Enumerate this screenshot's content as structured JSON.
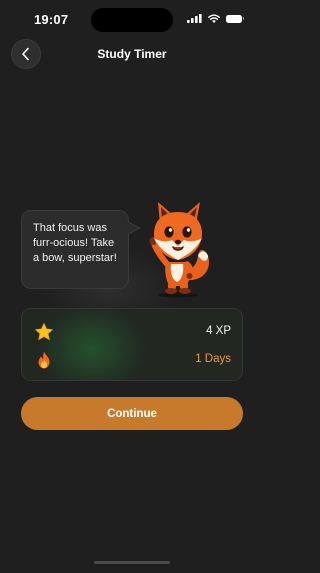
{
  "status_bar": {
    "time": "19:07",
    "icons": [
      "signal-icon",
      "wifi-icon",
      "battery-icon"
    ]
  },
  "header": {
    "title": "Study Timer",
    "back_icon": "chevron-left-icon"
  },
  "mascot": {
    "message": "That focus was furr-ocious! Take a bow, superstar!",
    "image": "fox-mascot-waving"
  },
  "stats": [
    {
      "icon": "star-icon",
      "value": "4 XP",
      "color": "#f4f4f4"
    },
    {
      "icon": "fire-icon",
      "value": "1 Days",
      "color": "#e79a3c"
    }
  ],
  "actions": {
    "continue_label": "Continue"
  },
  "colors": {
    "background": "#1f1f1f",
    "accent": "#c87a2c",
    "streak": "#e79a3c"
  }
}
